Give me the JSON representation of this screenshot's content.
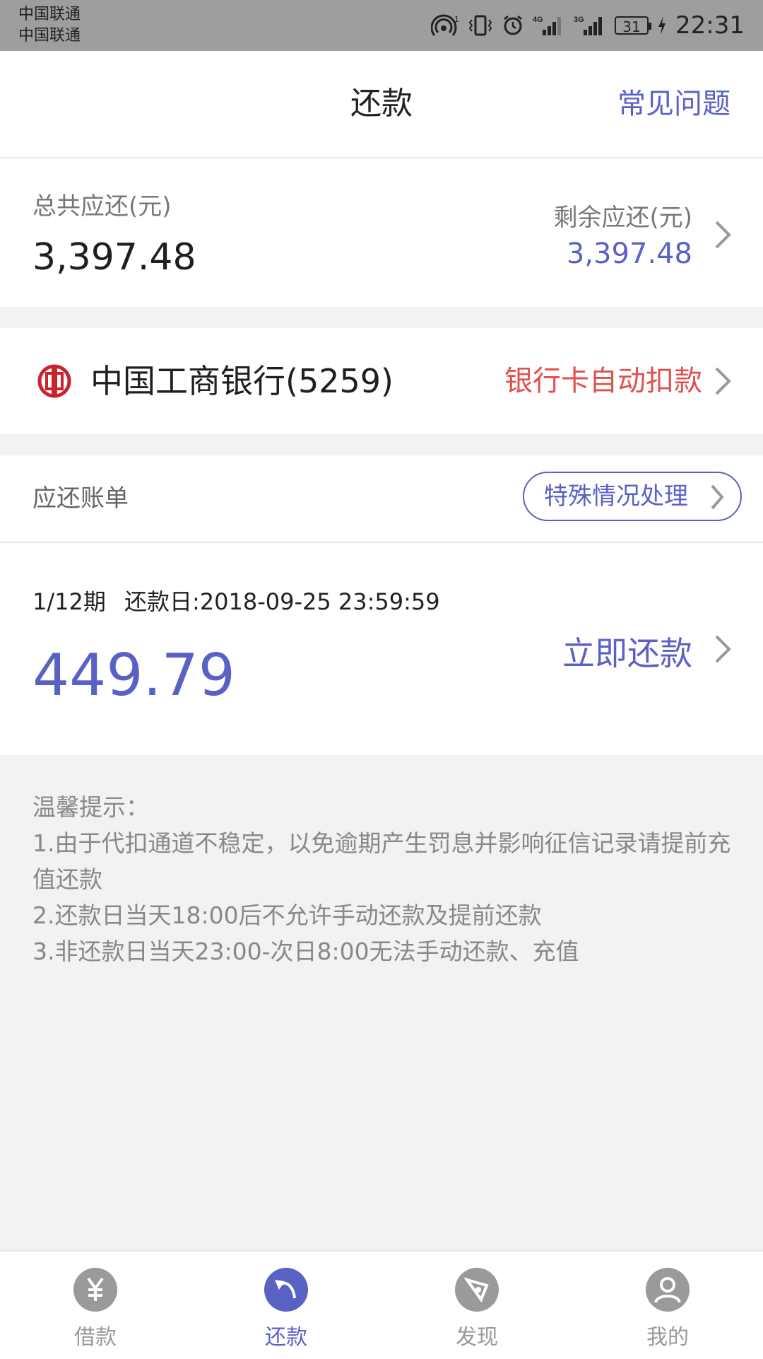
{
  "status_bar": {
    "carrier1": "中国联通",
    "carrier2": "中国联通",
    "signal1": "4G",
    "signal2": "3G",
    "battery": "31",
    "time": "22:31"
  },
  "nav": {
    "title": "还款",
    "faq": "常见问题"
  },
  "summary": {
    "total_label": "总共应还(元)",
    "total_value": "3,397.48",
    "remaining_label": "剩余应还(元)",
    "remaining_value": "3,397.48"
  },
  "bank": {
    "name": "中国工商银行(5259)",
    "auto_debit": "银行卡自动扣款",
    "logo_color": "#c8242b"
  },
  "bills": {
    "header_label": "应还账单",
    "special_button": "特殊情况处理",
    "item": {
      "period": "1/12期",
      "due_date": "还款日:2018-09-25 23:59:59",
      "amount": "449.79",
      "pay_now": "立即还款"
    }
  },
  "tips": {
    "title": "温馨提示：",
    "line1": "1.由于代扣通道不稳定，以免逾期产生罚息并影响征信记录请提前充值还款",
    "line2": "2.还款日当天18:00后不允许手动还款及提前还款",
    "line3": "3.非还款日当天23:00-次日8:00无法手动还款、充值"
  },
  "tabbar": {
    "items": [
      {
        "label": "借款",
        "icon": "yen-icon"
      },
      {
        "label": "还款",
        "icon": "repay-arrow-icon"
      },
      {
        "label": "发现",
        "icon": "compass-icon"
      },
      {
        "label": "我的",
        "icon": "user-icon"
      }
    ],
    "active_index": 1
  },
  "colors": {
    "accent": "#5962c4",
    "warning_red": "#e0504d",
    "inactive_gray": "#9a9a9a",
    "background": "#f2f2f2"
  }
}
